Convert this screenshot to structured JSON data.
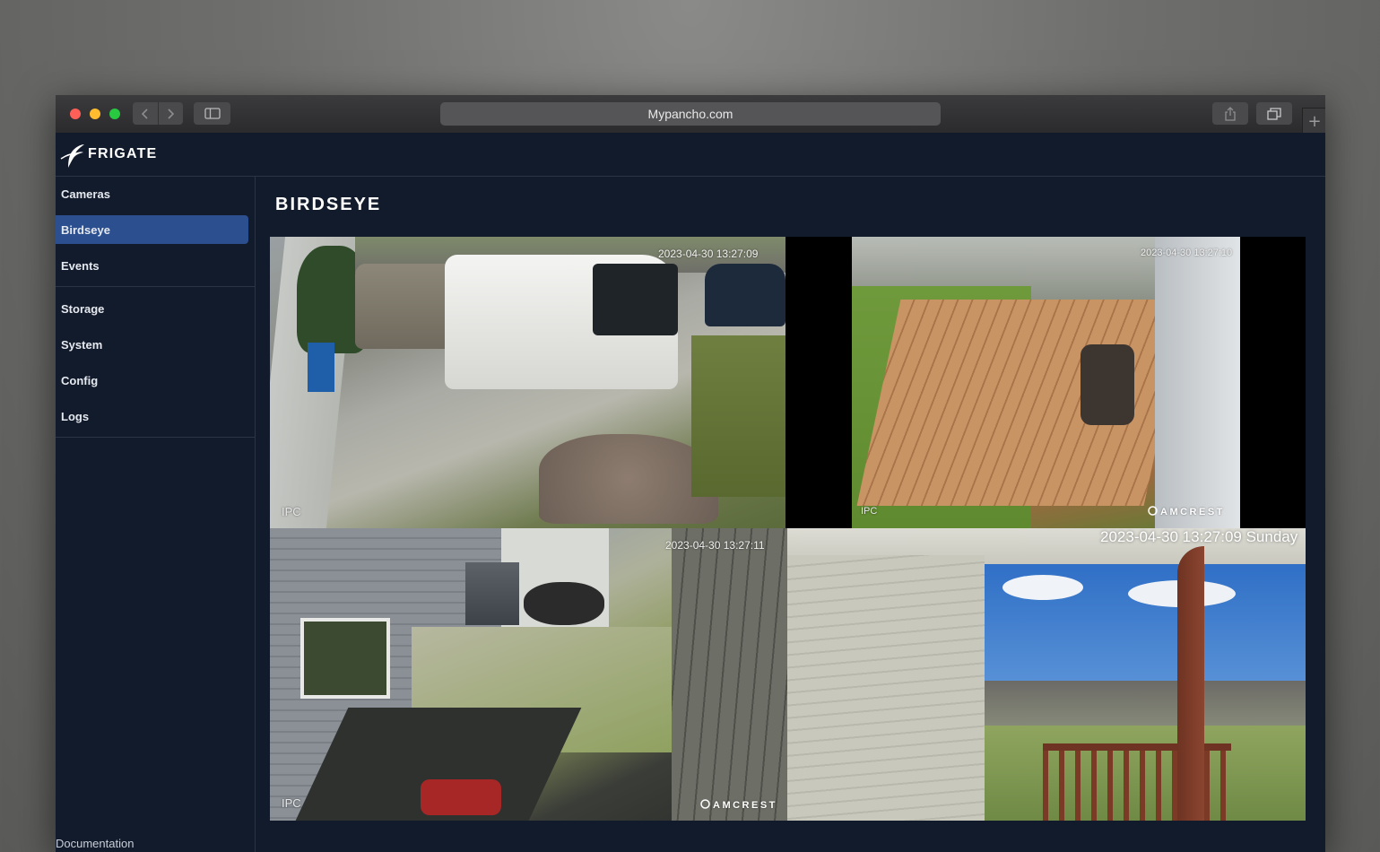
{
  "browser": {
    "url": "Mypancho.com",
    "new_tab_label": "+"
  },
  "app": {
    "brand": "FRIGATE"
  },
  "sidebar": {
    "items": [
      {
        "label": "Cameras",
        "active": false
      },
      {
        "label": "Birdseye",
        "active": true
      },
      {
        "label": "Events",
        "active": false
      },
      {
        "label": "Storage",
        "active": false
      },
      {
        "label": "System",
        "active": false
      },
      {
        "label": "Config",
        "active": false
      },
      {
        "label": "Logs",
        "active": false
      }
    ],
    "documentation": "Documentation"
  },
  "page": {
    "title": "BIRDSEYE"
  },
  "cameras": [
    {
      "timestamp": "2023-04-30 13:27:09",
      "overlay": "IPC",
      "brand": ""
    },
    {
      "timestamp": "2023-04-30 13:27:10",
      "overlay": "IPC",
      "brand": "AMCREST"
    },
    {
      "timestamp": "2023-04-30 13:27:11",
      "overlay": "IPC",
      "brand": "AMCREST"
    },
    {
      "timestamp": "2023-04-30 13:27:09 Sunday",
      "overlay": "",
      "brand": ""
    }
  ],
  "colors": {
    "background": "#121b2b",
    "active_nav": "#2b4f8f"
  }
}
